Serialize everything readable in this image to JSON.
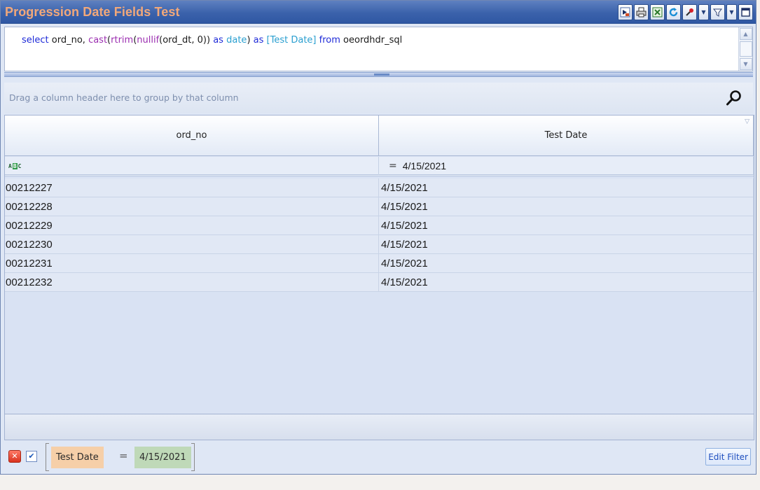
{
  "window": {
    "title": "Progression Date Fields Test"
  },
  "toolbar": {
    "icons": [
      "run-icon",
      "print-icon",
      "excel-export-icon",
      "refresh-icon",
      "tools-icon",
      "dropdown-icon",
      "filter-icon",
      "dropdown-icon",
      "maximize-icon"
    ]
  },
  "query": {
    "tokens": [
      {
        "t": "select",
        "k": "kw"
      },
      {
        "t": " ord_no, ",
        "k": "id"
      },
      {
        "t": "cast",
        "k": "fn"
      },
      {
        "t": "(",
        "k": "id"
      },
      {
        "t": "rtrim",
        "k": "fn"
      },
      {
        "t": "(",
        "k": "id"
      },
      {
        "t": "nullif",
        "k": "fn"
      },
      {
        "t": "(ord_dt, 0)) ",
        "k": "id"
      },
      {
        "t": "as",
        "k": "kw"
      },
      {
        "t": " ",
        "k": "id"
      },
      {
        "t": "date",
        "k": "br"
      },
      {
        "t": ") ",
        "k": "id"
      },
      {
        "t": "as",
        "k": "kw"
      },
      {
        "t": " ",
        "k": "id"
      },
      {
        "t": "[Test Date]",
        "k": "br"
      },
      {
        "t": " ",
        "k": "id"
      },
      {
        "t": "from",
        "k": "kw"
      },
      {
        "t": " oeordhdr_sql",
        "k": "id"
      }
    ]
  },
  "group_panel": {
    "hint": "Drag a column header here to group by that column"
  },
  "grid": {
    "columns": [
      "ord_no",
      "Test Date"
    ],
    "auto_filter": {
      "col2_operator": "=",
      "col2_value": "4/15/2021"
    },
    "rows": [
      [
        "00212227",
        "4/15/2021"
      ],
      [
        "00212228",
        "4/15/2021"
      ],
      [
        "00212229",
        "4/15/2021"
      ],
      [
        "00212230",
        "4/15/2021"
      ],
      [
        "00212231",
        "4/15/2021"
      ],
      [
        "00212232",
        "4/15/2021"
      ]
    ]
  },
  "filter_bar": {
    "field": "Test Date",
    "operator": "=",
    "value": "4/15/2021",
    "enabled": true,
    "edit_label": "Edit Filter"
  },
  "colors": {
    "title_text": "#f2a87a",
    "keyword": "#1f2bd8",
    "function": "#9b2eb0",
    "bracket_ident": "#2a9fd0"
  }
}
